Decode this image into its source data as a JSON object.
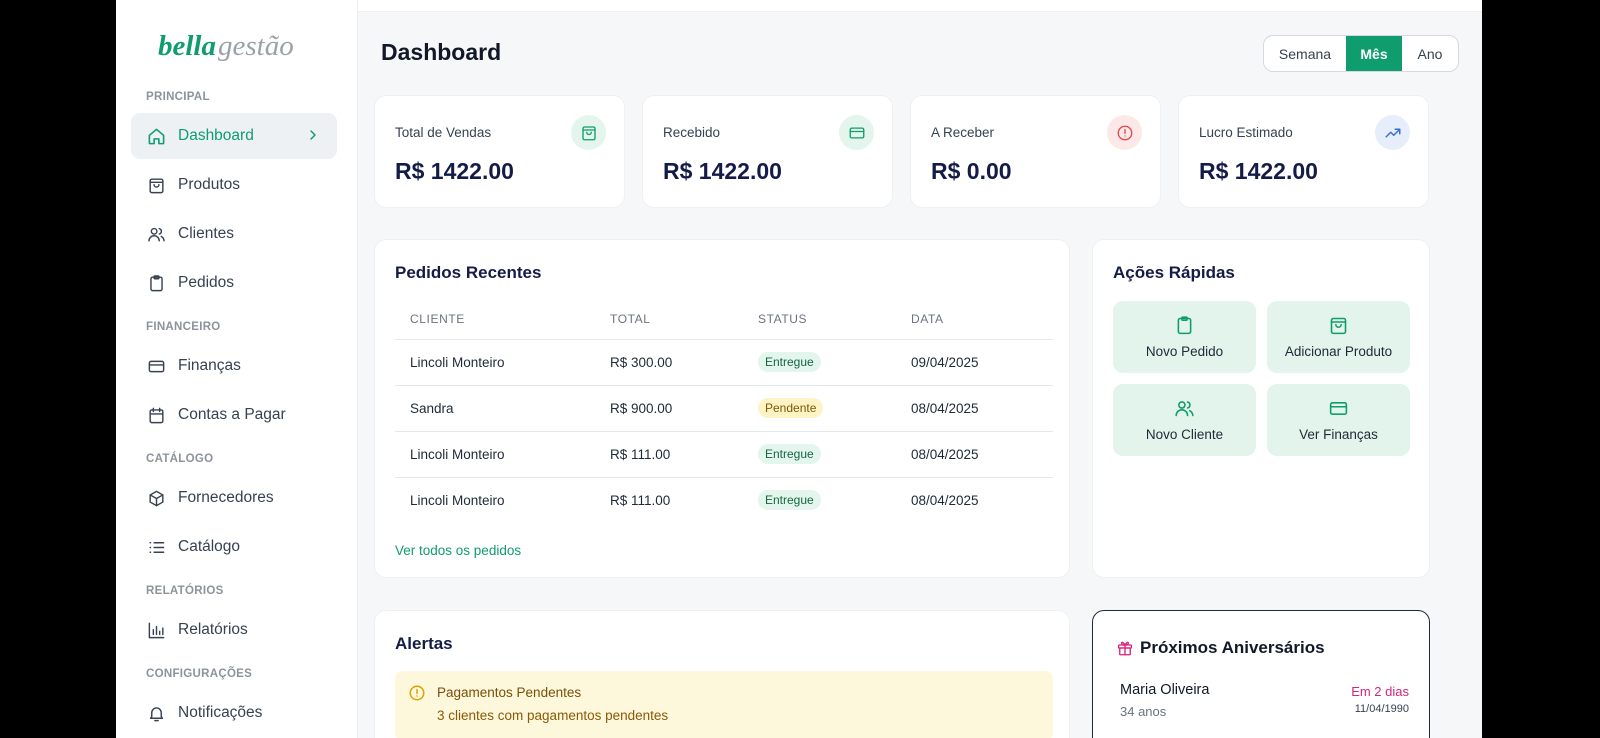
{
  "brand": {
    "part1": "bella",
    "part2": "gestão"
  },
  "sidebar": {
    "sections": [
      {
        "label": "PRINCIPAL"
      },
      {
        "label": "FINANCEIRO"
      },
      {
        "label": "CATÁLOGO"
      },
      {
        "label": "RELATÓRIOS"
      },
      {
        "label": "CONFIGURAÇÕES"
      }
    ],
    "items": [
      {
        "label": "Dashboard",
        "icon": "home-icon",
        "active": true
      },
      {
        "label": "Produtos",
        "icon": "shopping-bag-icon"
      },
      {
        "label": "Clientes",
        "icon": "users-icon"
      },
      {
        "label": "Pedidos",
        "icon": "clipboard-icon"
      },
      {
        "label": "Finanças",
        "icon": "credit-card-icon"
      },
      {
        "label": "Contas a Pagar",
        "icon": "calendar-icon"
      },
      {
        "label": "Fornecedores",
        "icon": "package-icon"
      },
      {
        "label": "Catálogo",
        "icon": "list-icon"
      },
      {
        "label": "Relatórios",
        "icon": "bar-chart-icon"
      },
      {
        "label": "Notificações",
        "icon": "bell-icon"
      }
    ]
  },
  "header": {
    "title": "Dashboard",
    "period": {
      "options": [
        "Semana",
        "Mês",
        "Ano"
      ],
      "selected": "Mês"
    }
  },
  "stats": [
    {
      "label": "Total de Vendas",
      "value": "R$ 1422.00",
      "icon": "shopping-bag-icon",
      "color": "#0f9d6e"
    },
    {
      "label": "Recebido",
      "value": "R$ 1422.00",
      "icon": "credit-card-icon",
      "color": "#0f9d6e"
    },
    {
      "label": "A Receber",
      "value": "R$ 0.00",
      "icon": "alert-circle-icon",
      "color": "#e5484d"
    },
    {
      "label": "Lucro Estimado",
      "value": "R$ 1422.00",
      "icon": "trending-up-icon",
      "color": "#3b6fd8"
    }
  ],
  "orders": {
    "title": "Pedidos Recentes",
    "columns": [
      "CLIENTE",
      "TOTAL",
      "STATUS",
      "DATA"
    ],
    "rows": [
      {
        "cliente": "Lincoli Monteiro",
        "total": "R$ 300.00",
        "status": "Entregue",
        "data": "09/04/2025"
      },
      {
        "cliente": "Sandra",
        "total": "R$ 900.00",
        "status": "Pendente",
        "data": "08/04/2025"
      },
      {
        "cliente": "Lincoli Monteiro",
        "total": "R$ 111.00",
        "status": "Entregue",
        "data": "08/04/2025"
      },
      {
        "cliente": "Lincoli Monteiro",
        "total": "R$ 111.00",
        "status": "Entregue",
        "data": "08/04/2025"
      }
    ],
    "view_all": "Ver todos os pedidos"
  },
  "quick_actions": {
    "title": "Ações Rápidas",
    "items": [
      {
        "label": "Novo Pedido",
        "icon": "clipboard-icon"
      },
      {
        "label": "Adicionar Produto",
        "icon": "shopping-bag-icon"
      },
      {
        "label": "Novo Cliente",
        "icon": "users-icon"
      },
      {
        "label": "Ver Finanças",
        "icon": "credit-card-icon"
      }
    ]
  },
  "alerts": {
    "title": "Alertas",
    "items": [
      {
        "title": "Pagamentos Pendentes",
        "text": "3 clientes com pagamentos pendentes"
      }
    ]
  },
  "birthdays": {
    "title": "Próximos Aniversários",
    "items": [
      {
        "name": "Maria Oliveira",
        "age": "34 anos",
        "when": "Em 2 dias",
        "date": "11/04/1990"
      }
    ]
  }
}
